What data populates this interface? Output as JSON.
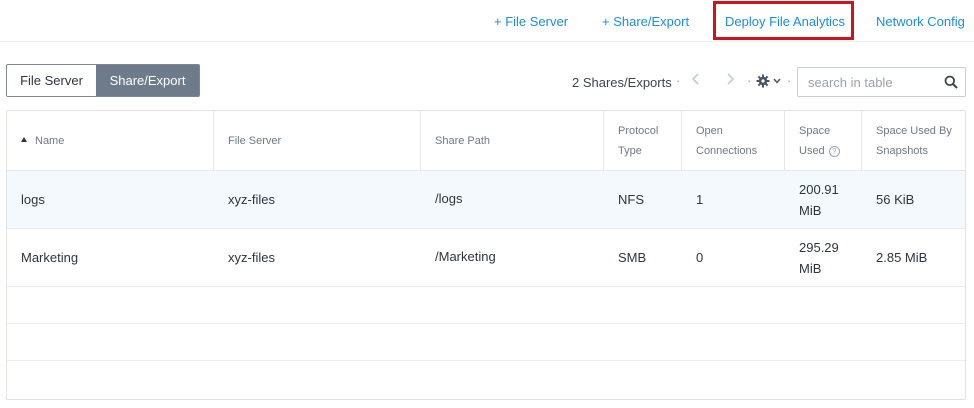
{
  "top_actions": {
    "add_file_server": "+ File Server",
    "add_share_export": "+ Share/Export",
    "deploy_file_analytics": "Deploy File Analytics",
    "network_config": "Network Config"
  },
  "toggle": {
    "file_server": "File Server",
    "share_export": "Share/Export",
    "active": "Share/Export"
  },
  "toolbar": {
    "count_label": "2 Shares/Exports",
    "separator": "·",
    "search_placeholder": "search in table"
  },
  "table": {
    "headers": {
      "name": "Name",
      "file_server": "File Server",
      "share_path": "Share Path",
      "protocol_line1": "Protocol",
      "protocol_line2": "Type",
      "open_line1": "Open",
      "open_line2": "Connections",
      "space_line1": "Space",
      "space_line2": "Used",
      "snap_line1": "Space Used By",
      "snap_line2": "Snapshots"
    },
    "rows": [
      {
        "name": "logs",
        "file_server": "xyz-files",
        "share_path": "/logs",
        "protocol": "NFS",
        "open_connections": "1",
        "space_used_1": "200.91",
        "space_used_2": "MiB",
        "snapshots": "56 KiB"
      },
      {
        "name": "Marketing",
        "file_server": "xyz-files",
        "share_path": "/Marketing",
        "protocol": "SMB",
        "open_connections": "0",
        "space_used_1": "295.29",
        "space_used_2": "MiB",
        "snapshots": "2.85 MiB"
      }
    ]
  },
  "colors": {
    "link_blue": "#1a8fd6",
    "highlight_red": "#c9151b",
    "toggle_active": "#6e7b8b"
  },
  "icons": [
    "plus-icon",
    "chevron-left-icon",
    "chevron-right-icon",
    "gear-icon",
    "chevron-down-icon",
    "search-icon",
    "sort-ascending-icon",
    "help-circle-icon"
  ]
}
